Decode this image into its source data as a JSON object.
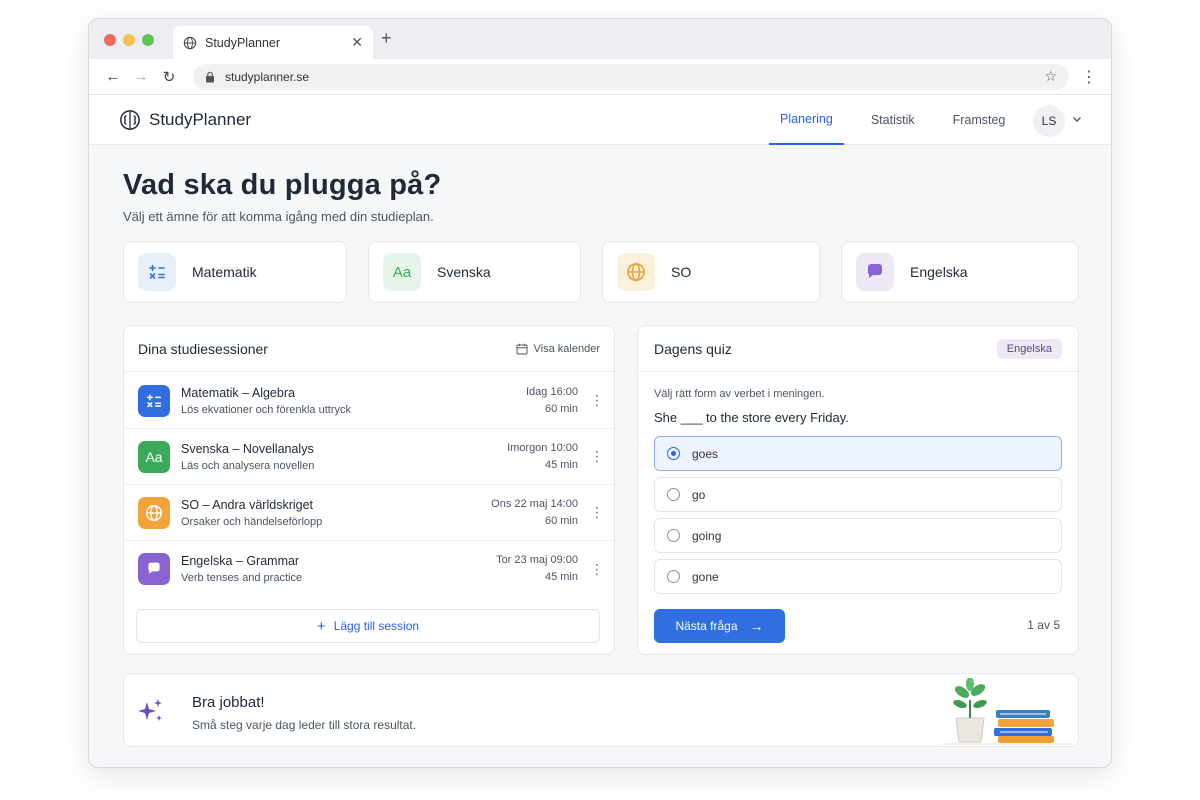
{
  "browser": {
    "tab_title": "StudyPlanner",
    "url": "studyplanner.se"
  },
  "header": {
    "logo_text": "StudyPlanner",
    "nav": [
      {
        "label": "Planering",
        "active": true
      },
      {
        "label": "Statistik",
        "active": false
      },
      {
        "label": "Framsteg",
        "active": false
      }
    ],
    "avatar_initials": "LS"
  },
  "hero": {
    "title": "Vad ska du plugga på?",
    "subtitle": "Välj ett ämne för att komma igång med din studieplan."
  },
  "subjects": [
    {
      "label": "Matematik",
      "icon": "math-icon",
      "color": "#e8eefc"
    },
    {
      "label": "Svenska",
      "icon": "aa-icon",
      "color": "#e6f4ea"
    },
    {
      "label": "SO",
      "icon": "globe-icon",
      "color": "#fdf0dc"
    },
    {
      "label": "Engelska",
      "icon": "chat-bubble-icon",
      "color": "#efe9f7"
    }
  ],
  "sessions": {
    "title": "Dina studiesessioner",
    "calendar_link": "Visa kalender",
    "items": [
      {
        "title": "Matematik – Algebra",
        "desc": "Lös ekvationer och förenkla uttryck",
        "time": "Idag 16:00",
        "duration": "60 min",
        "color": "#2f6fe0",
        "icon": "math-icon"
      },
      {
        "title": "Svenska – Novellanalys",
        "desc": "Läs och analysera novellen",
        "time": "Imorgon 10:00",
        "duration": "45 min",
        "color": "#3aa95a",
        "icon": "aa-icon"
      },
      {
        "title": "SO – Andra världskriget",
        "desc": "Orsaker och händelseförlopp",
        "time": "Ons 22 maj 14:00",
        "duration": "60 min",
        "color": "#f4a23a",
        "icon": "globe-icon"
      },
      {
        "title": "Engelska – Grammar",
        "desc": "Verb tenses and practice",
        "time": "Tor 23 maj 09:00",
        "duration": "45 min",
        "color": "#8a63d2",
        "icon": "chat-bubble-icon"
      }
    ],
    "add_label": "Lägg till session"
  },
  "quiz": {
    "title": "Dagens quiz",
    "badge": "Engelska",
    "instruction": "Välj rätt form av verbet i meningen.",
    "question": "She ___ to the store every Friday.",
    "options": [
      "goes",
      "go",
      "going",
      "gone"
    ],
    "selected_index": 0,
    "next_label": "Nästa fråga",
    "counter": "1 av 5"
  },
  "encouragement": {
    "title": "Bra jobbat!",
    "subtitle": "Små steg varje dag leder till stora resultat."
  }
}
